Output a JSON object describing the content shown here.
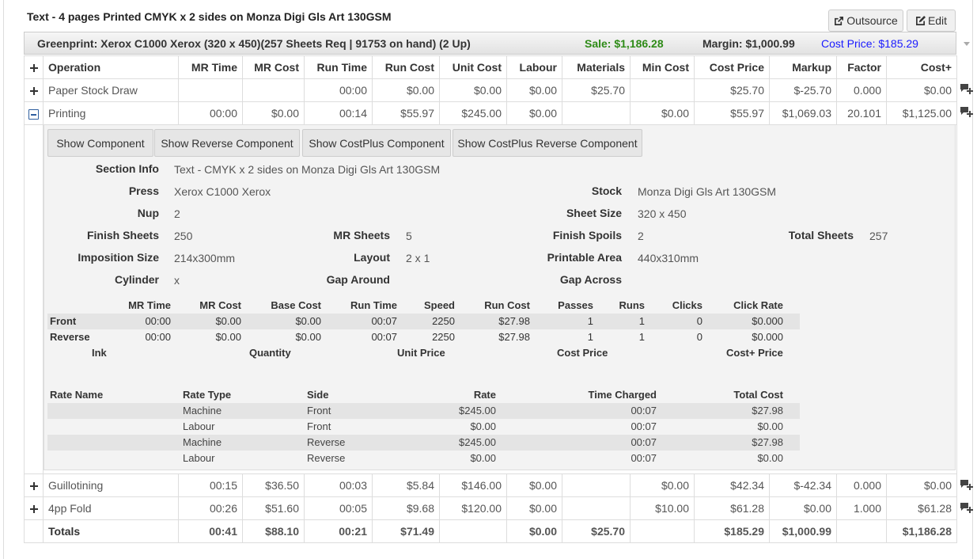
{
  "header": {
    "title": "Text - 4 pages Printed CMYK x 2 sides on Monza Digi Gls Art 130GSM",
    "outsource_label": "Outsource",
    "edit_label": "Edit"
  },
  "press_bar": {
    "label": "Greenprint: Xerox C1000 Xerox (320 x 450)(257 Sheets Req | 91753 on hand) (2 Up)",
    "sale": "Sale: $1,186.28",
    "margin": "Margin: $1,000.99",
    "cost_price": "Cost Price: $185.29",
    "sale_color": "#2e8b17",
    "cost_color": "#1a1aff"
  },
  "columns": [
    "Operation",
    "MR Time",
    "MR Cost",
    "Run Time",
    "Run Cost",
    "Unit Cost",
    "Labour",
    "Materials",
    "Min Cost",
    "Cost Price",
    "Markup",
    "Factor",
    "Cost+"
  ],
  "rows": {
    "paper": [
      "Paper Stock Draw",
      "",
      "",
      "00:00",
      "$0.00",
      "$0.00",
      "$0.00",
      "$25.70",
      "",
      "$25.70",
      "$-25.70",
      "0.000",
      "$0.00"
    ],
    "printing": [
      "Printing",
      "00:00",
      "$0.00",
      "00:14",
      "$55.97",
      "$245.00",
      "$0.00",
      "",
      "$0.00",
      "$55.97",
      "$1,069.03",
      "20.101",
      "$1,125.00"
    ],
    "guillotining": [
      "Guillotining",
      "00:15",
      "$36.50",
      "00:03",
      "$5.84",
      "$146.00",
      "$0.00",
      "",
      "$0.00",
      "$42.34",
      "$-42.34",
      "0.000",
      "$0.00"
    ],
    "fold": [
      "4pp Fold",
      "00:26",
      "$51.60",
      "00:05",
      "$9.68",
      "$120.00",
      "$0.00",
      "",
      "$10.00",
      "$61.28",
      "$0.00",
      "1.000",
      "$61.28"
    ],
    "totals": [
      "Totals",
      "00:41",
      "$88.10",
      "00:21",
      "$71.49",
      "",
      "$0.00",
      "$25.70",
      "",
      "$185.29",
      "$1,000.99",
      "",
      "$1,186.28"
    ]
  },
  "detail": {
    "buttons": [
      "Show Component",
      "Show Reverse Component",
      "Show CostPlus Component",
      "Show CostPlus Reverse Component"
    ],
    "info": {
      "section_info_label": "Section Info",
      "section_info": "Text - CMYK x 2 sides on Monza Digi Gls Art 130GSM",
      "press_label": "Press",
      "press": "Xerox C1000 Xerox",
      "stock_label": "Stock",
      "stock": "Monza Digi Gls Art 130GSM",
      "nup_label": "Nup",
      "nup": "2",
      "sheet_size_label": "Sheet Size",
      "sheet_size": "320 x 450",
      "finish_sheets_label": "Finish Sheets",
      "finish_sheets": "250",
      "mr_sheets_label": "MR Sheets",
      "mr_sheets": "5",
      "finish_spoils_label": "Finish Spoils",
      "finish_spoils": "2",
      "total_sheets_label": "Total Sheets",
      "total_sheets": "257",
      "imposition_label": "Imposition Size",
      "imposition": "214x300mm",
      "layout_label": "Layout",
      "layout": "2 x 1",
      "printable_label": "Printable Area",
      "printable": "440x310mm",
      "cylinder_label": "Cylinder",
      "cylinder": "x",
      "gap_around_label": "Gap Around",
      "gap_across_label": "Gap Across"
    },
    "run_headers": [
      "MR Time",
      "MR Cost",
      "Base Cost",
      "Run Time",
      "Speed",
      "Run Cost",
      "Passes",
      "Runs",
      "Clicks",
      "Click Rate"
    ],
    "run_rows": [
      [
        "Front",
        "00:00",
        "$0.00",
        "$0.00",
        "00:07",
        "2250",
        "$27.98",
        "1",
        "1",
        "0",
        "$0.000"
      ],
      [
        "Reverse",
        "00:00",
        "$0.00",
        "$0.00",
        "00:07",
        "2250",
        "$27.98",
        "1",
        "1",
        "0",
        "$0.000"
      ]
    ],
    "ink_headers": [
      "Ink",
      "Quantity",
      "Unit Price",
      "Cost Price",
      "Cost+ Price"
    ],
    "rate_headers": [
      "Rate Name",
      "Rate Type",
      "Side",
      "Rate",
      "Time Charged",
      "Total Cost"
    ],
    "rate_rows": [
      [
        "",
        "Machine",
        "Front",
        "$245.00",
        "00:07",
        "$27.98"
      ],
      [
        "",
        "Labour",
        "Front",
        "$0.00",
        "00:07",
        "$0.00"
      ],
      [
        "",
        "Machine",
        "Reverse",
        "$245.00",
        "00:07",
        "$27.98"
      ],
      [
        "",
        "Labour",
        "Reverse",
        "$0.00",
        "00:07",
        "$0.00"
      ]
    ]
  }
}
